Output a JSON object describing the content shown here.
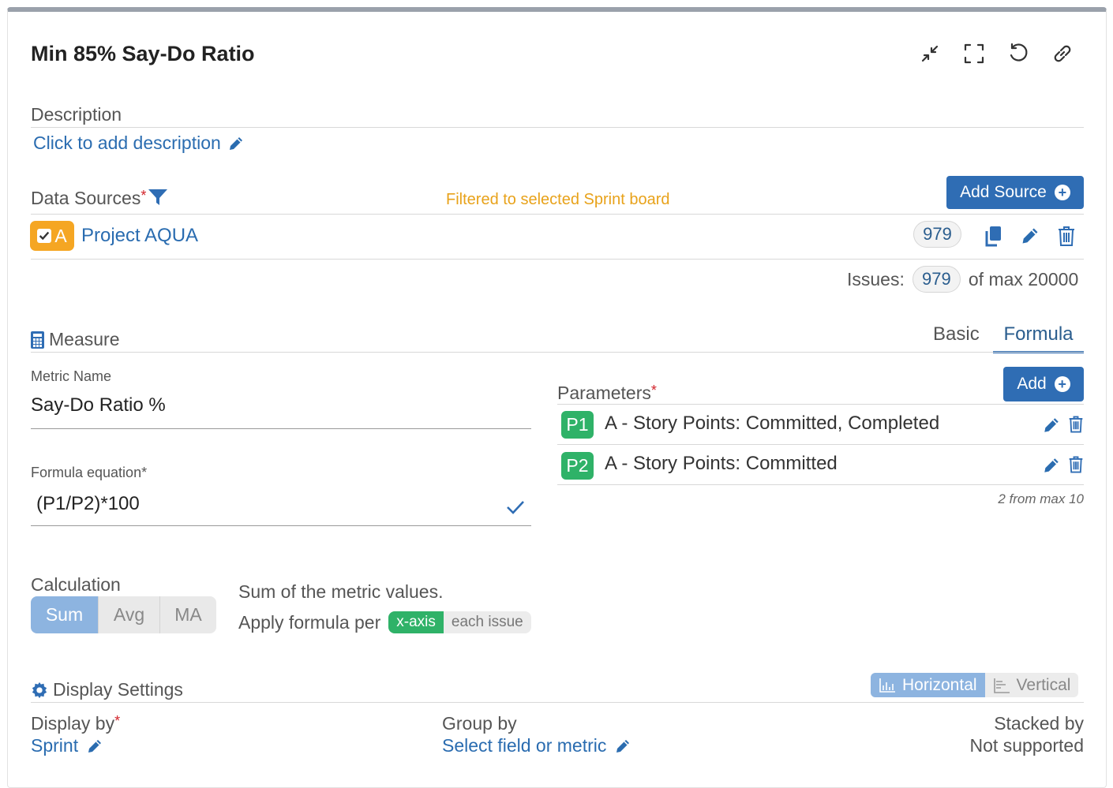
{
  "header": {
    "title": "Min 85% Say-Do Ratio"
  },
  "description": {
    "label": "Description",
    "add_link": "Click to add description"
  },
  "data_sources": {
    "label": "Data Sources",
    "required_mark": "*",
    "filter_note": "Filtered to selected Sprint board",
    "add_button": "Add Source",
    "source": {
      "badge_letter": "A",
      "name": "Project AQUA",
      "count": "979"
    },
    "issues_label": "Issues:",
    "issues_count": "979",
    "issues_max": "of max 20000"
  },
  "measure": {
    "label": "Measure",
    "tabs": [
      {
        "label": "Basic"
      },
      {
        "label": "Formula"
      }
    ],
    "metric_name_label": "Metric Name",
    "metric_name_value": "Say-Do Ratio %",
    "formula_label": "Formula equation*",
    "formula_value": "(P1/P2)*100",
    "parameters_label": "Parameters",
    "parameters_required": "*",
    "add_button": "Add",
    "parameters": [
      {
        "id": "P1",
        "text": "A - Story Points: Committed, Completed"
      },
      {
        "id": "P2",
        "text": "A - Story Points: Committed"
      }
    ],
    "param_limit": "2 from max 10"
  },
  "calculation": {
    "label": "Calculation",
    "options": [
      "Sum",
      "Avg",
      "MA"
    ],
    "selected": "Sum",
    "description": "Sum of the metric values.",
    "apply_label": "Apply formula per",
    "apply_options": [
      "x-axis",
      "each issue"
    ],
    "apply_selected": "x-axis"
  },
  "display": {
    "label": "Display Settings",
    "orientation": [
      "Horizontal",
      "Vertical"
    ],
    "orientation_selected": "Horizontal",
    "display_by_label": "Display by",
    "display_by_required": "*",
    "display_by_value": "Sprint",
    "group_by_label": "Group by",
    "group_by_value": "Select field or metric",
    "stacked_by_label": "Stacked by",
    "stacked_by_value": "Not supported"
  },
  "colors": {
    "accent": "#2f6db4",
    "link": "#2a6cb0",
    "green": "#2fb268",
    "orange": "#f5a623",
    "warning_text": "#e8a21a"
  }
}
